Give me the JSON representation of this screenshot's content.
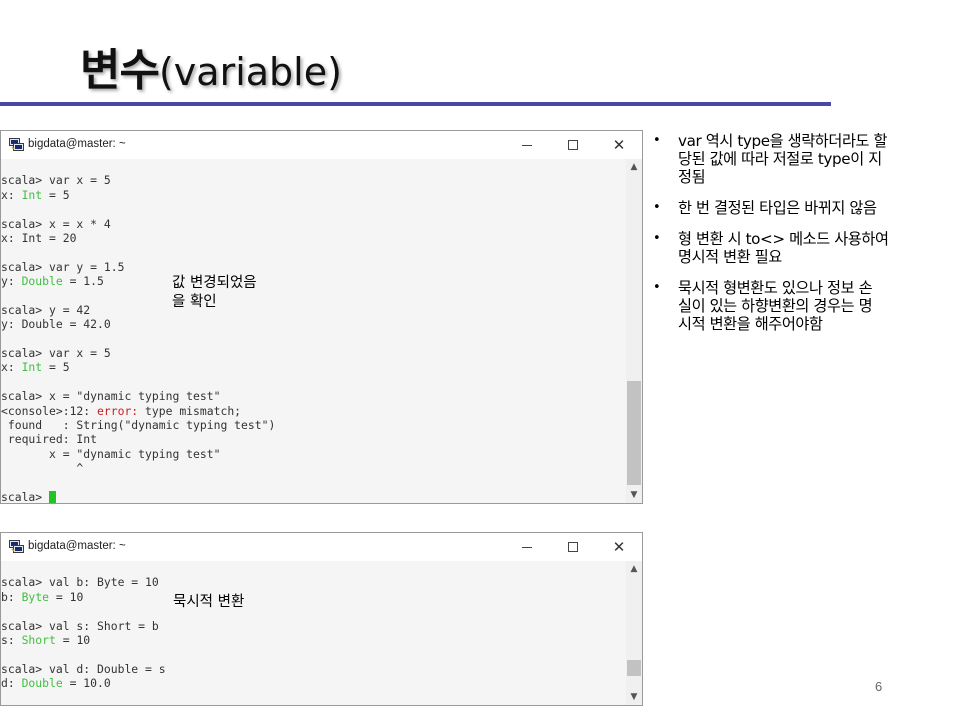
{
  "slide": {
    "title_main": "변수",
    "title_sub": "(variable)",
    "page_number": "6",
    "accent_color": "#4a4aa6"
  },
  "terminal_1": {
    "window_title": "bigdata@master: ~",
    "lines": [
      [
        {
          "t": ""
        }
      ],
      [
        {
          "t": "scala> var x = 5"
        }
      ],
      [
        {
          "t": "x: "
        },
        {
          "t": "Int",
          "c": "type"
        },
        {
          "t": " = 5"
        }
      ],
      [
        {
          "t": ""
        }
      ],
      [
        {
          "t": "scala> x = x * 4"
        }
      ],
      [
        {
          "t": "x: Int = 20"
        }
      ],
      [
        {
          "t": ""
        }
      ],
      [
        {
          "t": "scala> var y = 1.5"
        }
      ],
      [
        {
          "t": "y: "
        },
        {
          "t": "Double",
          "c": "type"
        },
        {
          "t": " = 1.5"
        }
      ],
      [
        {
          "t": ""
        }
      ],
      [
        {
          "t": "scala> y = 42"
        }
      ],
      [
        {
          "t": "y: Double = 42.0"
        }
      ],
      [
        {
          "t": ""
        }
      ],
      [
        {
          "t": "scala> var x = 5"
        }
      ],
      [
        {
          "t": "x: "
        },
        {
          "t": "Int",
          "c": "type"
        },
        {
          "t": " = 5"
        }
      ],
      [
        {
          "t": ""
        }
      ],
      [
        {
          "t": "scala> x = \"dynamic typing test\""
        }
      ],
      [
        {
          "t": "<console>:12: "
        },
        {
          "t": "error:",
          "c": "err"
        },
        {
          "t": " type mismatch;"
        }
      ],
      [
        {
          "t": " found   : String(\"dynamic typing test\")"
        }
      ],
      [
        {
          "t": " required: Int"
        }
      ],
      [
        {
          "t": "       x = \"dynamic typing test\""
        }
      ],
      [
        {
          "t": "           ^"
        }
      ],
      [
        {
          "t": ""
        }
      ],
      [
        {
          "t": "scala> "
        },
        {
          "t": "",
          "c": "cursor"
        }
      ]
    ]
  },
  "terminal_2": {
    "window_title": "bigdata@master: ~",
    "lines": [
      [
        {
          "t": ""
        }
      ],
      [
        {
          "t": "scala> val b: Byte = 10"
        }
      ],
      [
        {
          "t": "b: "
        },
        {
          "t": "Byte",
          "c": "type"
        },
        {
          "t": " = 10"
        }
      ],
      [
        {
          "t": ""
        }
      ],
      [
        {
          "t": "scala> val s: Short = b"
        }
      ],
      [
        {
          "t": "s: "
        },
        {
          "t": "Short",
          "c": "type"
        },
        {
          "t": " = 10"
        }
      ],
      [
        {
          "t": ""
        }
      ],
      [
        {
          "t": "scala> val d: Double = s"
        }
      ],
      [
        {
          "t": "d: "
        },
        {
          "t": "Double",
          "c": "type"
        },
        {
          "t": " = 10.0"
        }
      ]
    ]
  },
  "annotations": {
    "note_1_line_1": "값 변경되었음",
    "note_1_line_2": "을 확인",
    "note_2": "묵시적 변환"
  },
  "bullets": [
    {
      "lines": [
        "var 역시 type을 생략하더라도 할",
        "당된 값에 따라 저절로 type이 지",
        "정됨"
      ]
    },
    {
      "lines": [
        "한 번 결정된 타입은 바뀌지 않음"
      ]
    },
    {
      "lines": [
        "형 변환 시 to<> 메소드 사용하여",
        "명시적 변환 필요"
      ]
    },
    {
      "lines": [
        "묵시적 형변환도 있으나 정보 손",
        "실이 있는 하향변환의 경우는 명",
        "시적 변환을 해주어야함"
      ]
    }
  ],
  "icons": {
    "app": "putty-terminal-icon",
    "minimize": "minimize-icon",
    "maximize": "maximize-icon",
    "close": "close-icon",
    "scroll_up": "chevron-up-icon",
    "scroll_down": "chevron-down-icon"
  }
}
